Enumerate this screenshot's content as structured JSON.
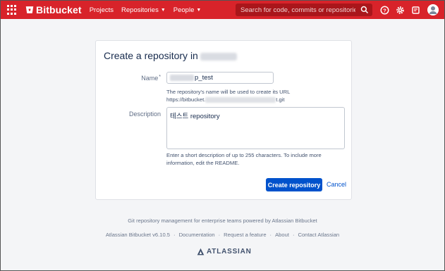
{
  "header": {
    "brand": "Bitbucket",
    "nav": {
      "projects": "Projects",
      "repositories": "Repositories",
      "people": "People"
    },
    "search_placeholder": "Search for code, commits or repositories...",
    "accent_color": "#d8232a"
  },
  "form": {
    "title": "Create a repository in",
    "name_label": "Name",
    "name_required_mark": "*",
    "name_value": "p_test",
    "name_help_line1": "The repository's name will be used to create its URL",
    "name_help_url_prefix": "https://bitbucket.",
    "name_help_url_suffix": "t.git",
    "description_label": "Description",
    "description_value": "테스트 repository",
    "description_help": "Enter a short description of up to 255 characters. To include more information, edit the README.",
    "create_button": "Create repository",
    "cancel_link": "Cancel"
  },
  "footer": {
    "tagline": "Git repository management for enterprise teams powered by Atlassian Bitbucket",
    "links": [
      "Atlassian Bitbucket v6.10.5",
      "Documentation",
      "Request a feature",
      "About",
      "Contact Atlassian"
    ],
    "separator": "·",
    "logo_text": "ATLASSIAN"
  }
}
